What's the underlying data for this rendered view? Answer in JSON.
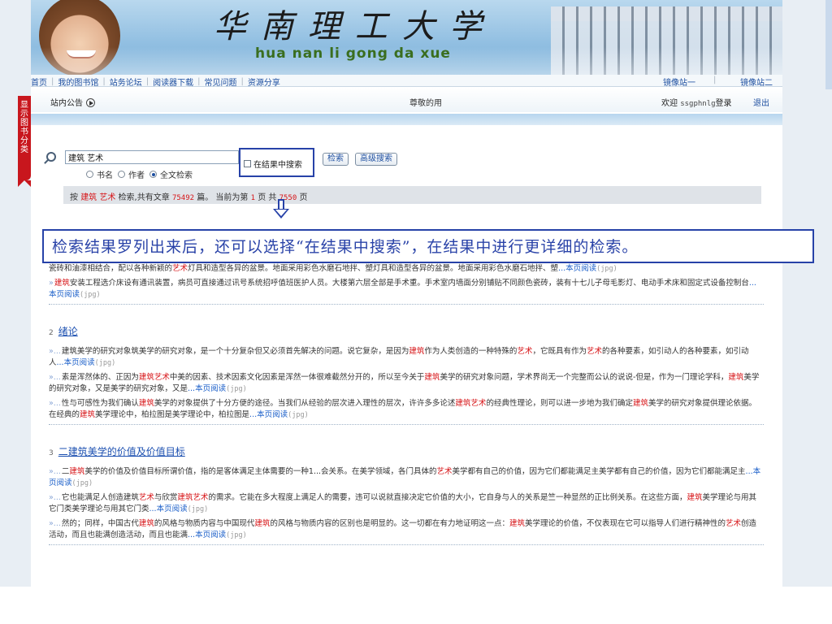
{
  "banner": {
    "calligraphy": "华南理工大学",
    "pinyin": "hua nan li gong da xue"
  },
  "topnav": {
    "links": [
      "首页",
      "我的图书馆",
      "站务论坛",
      "阅读器下载",
      "常见问题",
      "资源分享"
    ],
    "mirror1": "镜像站一",
    "mirror2": "镜像站二"
  },
  "side_tab": "显示图书分类",
  "noticebar": {
    "notice": "站内公告",
    "greeting": "尊敬的用",
    "welcome": "欢迎",
    "user": "ssgphnlg",
    "login": "登录",
    "logout": "退出"
  },
  "search": {
    "query": "建筑 艺术",
    "scopes": [
      "书名",
      "作者",
      "全文检索"
    ],
    "selected_scope": "全文检索",
    "within_label": "在结果中搜索",
    "search_button": "检索",
    "advanced_button": "高级搜索"
  },
  "summary": {
    "prefix": "按",
    "keyword": "建筑 艺术",
    "mid": "检索,共有文章",
    "total": "75492",
    "mid2": "篇。 当前为第",
    "page": "1",
    "mid3": "页 共",
    "pages": "7550",
    "suffix": "页"
  },
  "annotation": "检索结果罗列出来后，还可以选择“在结果中搜索”，在结果中进行更详细的检索。",
  "results": {
    "first_snippets": [
      {
        "segments": [
          [
            "瓷砖和油漆相结合，配以各种新颖的",
            ""
          ],
          [
            "艺术",
            "kw"
          ],
          [
            "灯具和造型各异的盆景。地面采用彩色水磨石地拌、塑灯具和造型各异的盆景。地面采用彩色水磨石地拌、塑",
            ""
          ]
        ],
        "more": "本页阅读",
        "fmt": "(jpg)"
      },
      {
        "segments": [
          [
            "»",
            "lead"
          ],
          [
            "建筑",
            "kw"
          ],
          [
            "安装工程选介床设有通讯装置，病员可直接通过讯号系统招呼值班医护人员。大楼第六层全部是手术重。手术室内墙面分别铺贴不同颜色瓷砖，装有十七儿子母毛影灯、电动手术床和固定式设备控制台",
            ""
          ]
        ],
        "more": "本页阅读",
        "fmt": "(jpg)"
      }
    ],
    "items": [
      {
        "index": "2",
        "title": "绪论",
        "snippets": [
          {
            "segments": [
              [
                "»...",
                "lead"
              ],
              [
                "建筑美学的研究对象筑美学的研究对象，是一个十分复杂但又必须首先解决的问题。说它复杂，是因为",
                ""
              ],
              [
                "建筑",
                "kw"
              ],
              [
                "作为人类创造的一种特殊的",
                ""
              ],
              [
                "艺术",
                "kw"
              ],
              [
                "，它既具有作为",
                ""
              ],
              [
                "艺术",
                "kw"
              ],
              [
                "的各种要素，如引动人的各种要素，如引动人",
                ""
              ]
            ],
            "more": "本页阅读",
            "fmt": "(jpg)"
          },
          {
            "segments": [
              [
                "»...",
                "lead"
              ],
              [
                "素是浑然体的、正因为",
                ""
              ],
              [
                "建筑艺术",
                "kw"
              ],
              [
                "中美的因素、技术因素文化因素是浑然一体很难截然分开的，所以至今关于",
                ""
              ],
              [
                "建筑",
                "kw"
              ],
              [
                "美学的研究对象问题，学术界尚无一个完整而公认的说说-但是，作为一门理论学科，",
                ""
              ],
              [
                "建筑",
                "kw"
              ],
              [
                "美学的研究对象，又是美学的研究对象，又是",
                ""
              ]
            ],
            "more": "本页阅读",
            "fmt": "(jpg)"
          },
          {
            "segments": [
              [
                "»...",
                "lead"
              ],
              [
                "性与可感性为我们确认",
                ""
              ],
              [
                "建筑",
                "kw"
              ],
              [
                "美学的对象提供了十分方便的途径。当我们从经验的层次进入理性的层次，许许多多论述",
                ""
              ],
              [
                "建筑艺术",
                "kw"
              ],
              [
                "的经典性理论，则可以进一步地为我们确定",
                ""
              ],
              [
                "建筑",
                "kw"
              ],
              [
                "美学的研究对象提供理论依据。在经典的",
                ""
              ],
              [
                "建筑",
                "kw"
              ],
              [
                "美学理论中，柏拉图是美学理论中，柏拉图是",
                ""
              ]
            ],
            "more": "本页阅读",
            "fmt": "(jpg)"
          }
        ]
      },
      {
        "index": "3",
        "title": "二建筑美学的价值及价值目标",
        "snippets": [
          {
            "segments": [
              [
                "»...",
                "lead"
              ],
              [
                "二",
                ""
              ],
              [
                "建筑",
                "kw"
              ],
              [
                "美学的价值及价值目标所谓价值，指的是客体满足主体需要的一种1...会关系。在美学领域，各门具体的",
                ""
              ],
              [
                "艺术",
                "kw"
              ],
              [
                "美学都有自己的价值，因为它们都能满足主美学都有自己的价值，因为它们都能满足主",
                ""
              ]
            ],
            "more": "本页阅读",
            "fmt": "(jpg)"
          },
          {
            "segments": [
              [
                "»...",
                "lead"
              ],
              [
                "它也能满足人创造建筑",
                ""
              ],
              [
                "艺术",
                "kw"
              ],
              [
                "与欣赏",
                ""
              ],
              [
                "建筑艺术",
                "kw"
              ],
              [
                "的需求。它能在多大程度上满足人的需要，违可以说就直接决定它价值的大小，它自身与人的关系是竺一种显然的正比例关系。在这些方面，",
                ""
              ],
              [
                "建筑",
                "kw"
              ],
              [
                "美学理论与用其它门类美学理论与用其它门类",
                ""
              ]
            ],
            "more": "本页阅读",
            "fmt": "(jpg)"
          },
          {
            "segments": [
              [
                "»...",
                "lead"
              ],
              [
                "然的；同样，中国古代",
                ""
              ],
              [
                "建筑",
                "kw"
              ],
              [
                "的风格与物质内容与中国现代",
                ""
              ],
              [
                "建筑",
                "kw"
              ],
              [
                "的风格与物质内容的区别也是明显的。这一切都在有力地证明这一点：",
                ""
              ],
              [
                "建筑",
                "kw"
              ],
              [
                "美学理论的价值，不仅表现在它可以指导人们进行精神性的",
                ""
              ],
              [
                "艺术",
                "kw"
              ],
              [
                "创造活动，而且也能满创造活动，而且也能满",
                ""
              ]
            ],
            "more": "本页阅读",
            "fmt": "(jpg)"
          }
        ]
      }
    ]
  },
  "colors": {
    "keyword": "#d71518",
    "link": "#1b4fb0",
    "annotation": "#2a43a8",
    "side_tab": "#c8161d"
  }
}
